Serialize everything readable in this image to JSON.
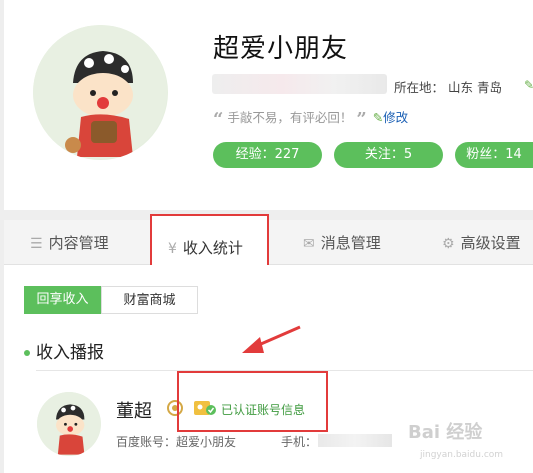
{
  "profile": {
    "name": "超爱小朋友",
    "location_label": "所在地：",
    "location_value": "山东 青岛",
    "motto": "手敲不易，有评必回！",
    "edit_label": "修改",
    "stats": [
      {
        "label": "经验：227"
      },
      {
        "label": "关注：5"
      },
      {
        "label": "粉丝：14"
      }
    ]
  },
  "tabs": [
    {
      "label": "内容管理",
      "icon": "list-icon"
    },
    {
      "label": "收入统计",
      "icon": "yen-icon",
      "active": true
    },
    {
      "label": "消息管理",
      "icon": "mail-icon"
    },
    {
      "label": "高级设置",
      "icon": "gear-icon"
    }
  ],
  "subtabs": [
    {
      "label": "回享收入",
      "active": true
    },
    {
      "label": "财富商城"
    }
  ],
  "section_title": "收入播报",
  "user": {
    "name": "董超",
    "verify_text": "已认证账号信息",
    "account": "百度账号：超爱小朋友",
    "phone_label": "手机："
  },
  "watermark": {
    "main": "Bai 经验",
    "sub": "jingyan.baidu.com"
  },
  "colors": {
    "accent_green": "#5cbf5c",
    "highlight_red": "#e23b3b",
    "link_blue": "#1a5fb4"
  }
}
